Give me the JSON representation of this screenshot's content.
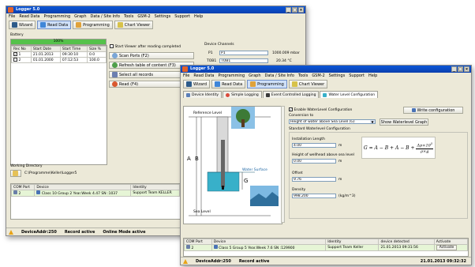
{
  "back_window": {
    "title": "Logger 5.0",
    "menu": [
      "File",
      "Read Data",
      "Programming",
      "Graph",
      "Data / Site Info",
      "Tools",
      "GSM-2",
      "Settings",
      "Support",
      "Help"
    ],
    "toolbar": {
      "wizard": "Wizard",
      "read_data": "Read Data",
      "programming": "Programming",
      "chart_viewer": "Chart Viewer"
    },
    "battery": {
      "label": "Battery",
      "percent": "100%",
      "level": 1.0
    },
    "records": {
      "headers": [
        "Rec No",
        "Start Date",
        "Start Time",
        "Size %"
      ],
      "rows": [
        {
          "no": "1",
          "date": "21.01.2013",
          "time": "09:30:10",
          "size": "0.0"
        },
        {
          "no": "2",
          "date": "01.01.2000",
          "time": "07:12:53",
          "size": "100.0"
        }
      ]
    },
    "start_viewer_label": "Start Viewer after reading completed",
    "buttons": {
      "scan": "Scan Ports (F2)",
      "refresh": "Refresh table of content (F3)",
      "select_all": "Select all records",
      "read": "Read (F4)"
    },
    "device_channels": {
      "label": "Device Channels",
      "rows": [
        {
          "name": "P1",
          "value": "P1",
          "reading": "1000.009 mbar"
        },
        {
          "name": "TOB1",
          "value": "TOB1",
          "reading": "20.34 °C"
        }
      ]
    },
    "working_dir": {
      "label": "Working Directory",
      "path": "C:\\Programme\\Keller\\Logger5"
    },
    "ports": {
      "headers": [
        "COM Port",
        "Device",
        "Identity"
      ],
      "row": {
        "port": "2",
        "device": "Class 10 Group 2 Year.Week 4.47 SN :1037",
        "identity": "Support Team KELLER"
      }
    },
    "status": {
      "addr": "DeviceAddr:250",
      "record": "Record active",
      "online": "Online Mode active"
    }
  },
  "front_window": {
    "title": "Logger 5.0",
    "menu": [
      "File",
      "Read Data",
      "Programming",
      "Graph",
      "Data / Site Info",
      "Tools",
      "GSM-2",
      "Settings",
      "Support",
      "Help"
    ],
    "toolbar": {
      "wizard": "Wizard",
      "read_data": "Read Data",
      "programming": "Programming",
      "chart_viewer": "Chart Viewer"
    },
    "tabs": [
      "Device Identity",
      "Simple Logging",
      "Event Controlled Logging",
      "Water Level Configuration"
    ],
    "enable_label": "Enable WaterLevel Configuration",
    "write_button": "Write configuration",
    "conversion_label": "Conversion to",
    "conversion_value": "Height of water above Sea Level (G)",
    "show_graph_button": "Show Waterlevel Graph",
    "section_title": "Standard Waterlevel Configuration",
    "fields": [
      {
        "label": "Installation Length",
        "value": "4.00",
        "unit": "m"
      },
      {
        "label": "Height of wellhead above sea level",
        "value": "0.00",
        "unit": "m"
      },
      {
        "label": "Offset",
        "value": "9.76",
        "unit": "m"
      },
      {
        "label": "Density",
        "value": "998.200",
        "unit": "(kg/m^3)"
      }
    ],
    "diagram": {
      "reference": "Reference Level",
      "a": "A",
      "b": "B",
      "g": "G",
      "surface": "Water Surface",
      "sea": "Sea Level"
    },
    "ports": {
      "headers": [
        "COM Port",
        "Device",
        "Identity",
        "device detected",
        "Activate"
      ],
      "row": {
        "port": "2",
        "device": "Class 5 Group 5 Year.Week 7.6 SN :129900",
        "identity": "Support Team Keller",
        "detected": "21.01.2013 09:31:56",
        "activate": "Activate"
      }
    },
    "status": {
      "addr": "DeviceAddr:250",
      "record": "Record active",
      "datetime": "21.01.2013 09:32:32"
    }
  },
  "colors": {
    "titlebar": "#0a56d8",
    "face": "#ece9d8",
    "battery": "#55c24a",
    "water": "#38b0c9"
  }
}
